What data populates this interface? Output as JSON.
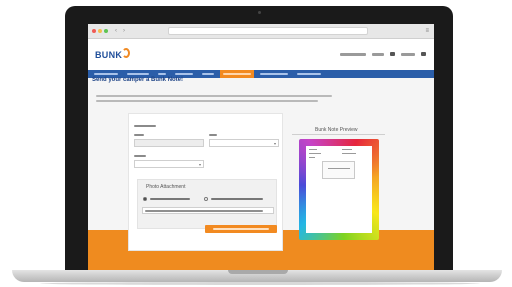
{
  "browser": {
    "back_label": "‹",
    "forward_label": "›"
  },
  "site": {
    "logo_text": "BUNK"
  },
  "page": {
    "title": "Send your camper a Bunk Note!"
  },
  "photo": {
    "title": "Photo Attachment"
  },
  "preview": {
    "title": "Bunk Note Preview"
  },
  "colors": {
    "nav_blue": "#2b5ea9",
    "brand_orange": "#f28a21",
    "logo_blue": "#1f4e9a"
  },
  "icons": {
    "logo": "bunk-logo-icon",
    "select_caret": "chevron-down-icon"
  }
}
